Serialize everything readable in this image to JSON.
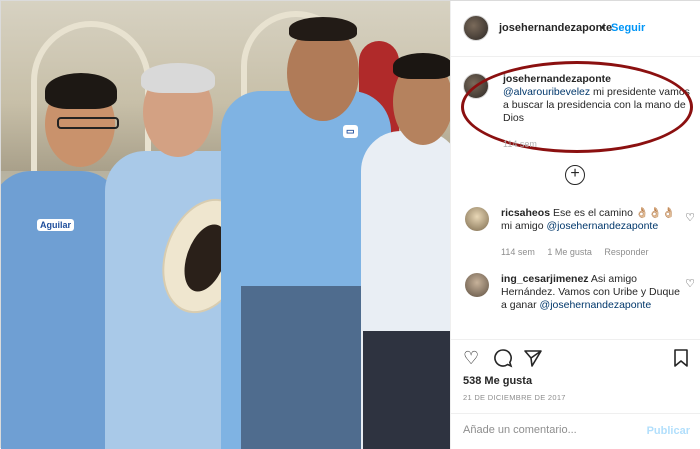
{
  "post": {
    "author": "josehernandezaponte",
    "follow_label": "Seguir",
    "separator": "•",
    "photo_badges": {
      "shirt_name": "Aguilar"
    }
  },
  "caption": {
    "author": "josehernandezaponte",
    "mention": "@alvarouribevelez",
    "text": " mi presidente vamos a buscar la presidencia con la mano de Dios",
    "time": "114 sem"
  },
  "comments": [
    {
      "author": "ricsaheos",
      "text": "Ese es el camino 👌🏼👌🏼👌🏼 mi amigo ",
      "mention": "@josehernandezaponte",
      "time": "114 sem",
      "likes": "1 Me gusta",
      "reply": "Responder"
    },
    {
      "author": "ing_cesarjimenez",
      "text": "Asi amigo Hernández. Vamos con Uribe y Duque a ganar ",
      "mention": "@josehernandezaponte",
      "time": "",
      "likes": "",
      "reply": ""
    }
  ],
  "actions": {
    "like_icon": "heart-icon",
    "comment_icon": "comment-icon",
    "share_icon": "share-icon",
    "save_icon": "bookmark-icon"
  },
  "likes_count": "538 Me gusta",
  "date": "21 DE DICIEMBRE DE 2017",
  "comment_box": {
    "placeholder": "Añade un comentario...",
    "publish": "Publicar"
  },
  "colors": {
    "link": "#0095f6",
    "mention": "#00376b",
    "highlight_oval": "#8b1010",
    "muted": "#8e8e8e"
  }
}
